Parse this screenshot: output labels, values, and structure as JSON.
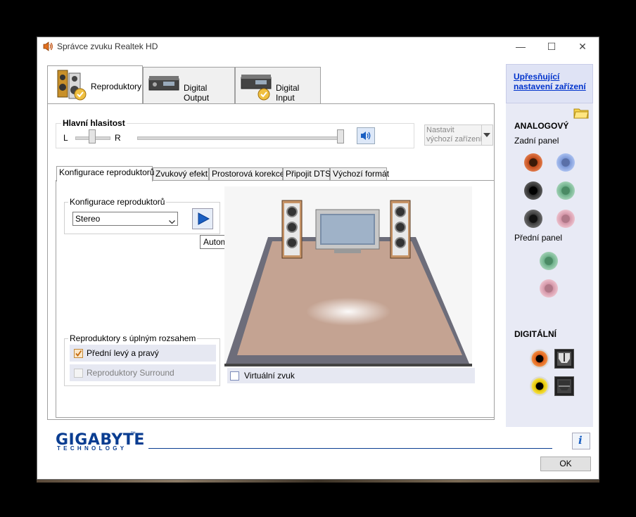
{
  "window": {
    "title": "Správce zvuku Realtek HD",
    "minimize": "—",
    "maximize": "☐",
    "close": "✕"
  },
  "main_tabs": [
    {
      "label": "Reproduktory"
    },
    {
      "label": "Digital Output"
    },
    {
      "label": "Digital Input"
    }
  ],
  "volume": {
    "group_label": "Hlavní hlasitost",
    "left": "L",
    "right": "R",
    "balance": 0.5,
    "level": 1.0
  },
  "default_device": {
    "label_line1": "Nastavit",
    "label_line2": "výchozí zařízení"
  },
  "sub_tabs": [
    {
      "label": "Konfigurace reproduktorů"
    },
    {
      "label": "Zvukový efekt"
    },
    {
      "label": "Prostorová korekce"
    },
    {
      "label": "Připojit DTS"
    },
    {
      "label": "Výchozí formát"
    }
  ],
  "speaker_config": {
    "group_label": "Konfigurace reproduktorů",
    "selected": "Stereo",
    "tooltip": "Automatický test"
  },
  "full_range": {
    "group_label": "Reproduktory s úplným rozsahem",
    "front": {
      "label": "Přední levý a pravý",
      "checked": true
    },
    "surround": {
      "label": "Reproduktory Surround",
      "checked": false
    }
  },
  "virtual_sound": {
    "label": "Virtuální zvuk",
    "checked": false
  },
  "right_panel": {
    "link": "Upřesňující nastavení zařízení",
    "link_line1": "Upřesňující",
    "link_line2": "nastavení zařízení",
    "analog_heading": "ANALOGOVÝ",
    "back_panel": "Zadní panel",
    "front_panel": "Přední panel",
    "digital_heading": "DIGITÁLNÍ",
    "jack_colors": {
      "orange": "#c04a1a",
      "blue": "#6e8fcf",
      "black": "#1a1a1a",
      "green": "#5aa07a",
      "gray": "#3a3a3a",
      "pink": "#d496a8"
    }
  },
  "footer": {
    "brand": "GIGABYTE",
    "brand_tm": "™",
    "brand_sub": "TECHNOLOGY",
    "ok": "OK",
    "info_icon": "i"
  },
  "colors": {
    "accent": "#0a3d91",
    "link": "#0033cc",
    "play": "#1a5fc2"
  }
}
